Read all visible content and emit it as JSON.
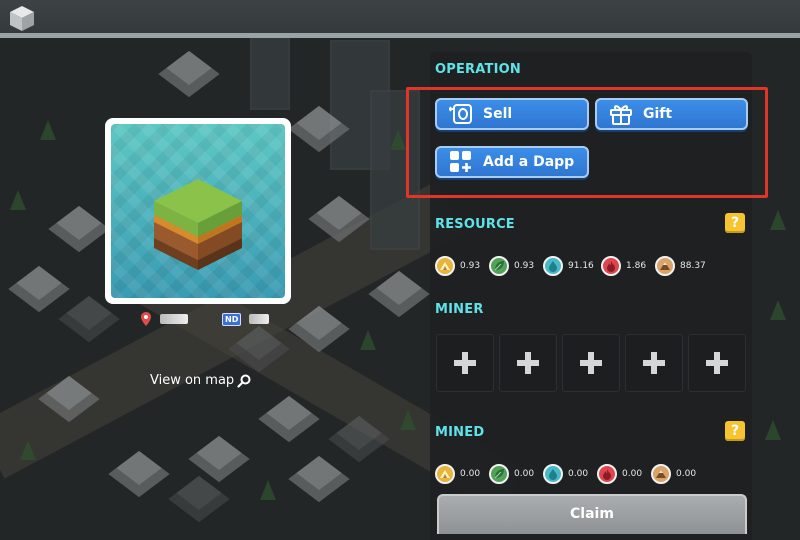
{
  "land": {
    "view_on_map_label": "View on map"
  },
  "operation": {
    "title": "OPERATION",
    "sell_label": "Sell",
    "gift_label": "Gift",
    "add_dapp_label": "Add a Dapp"
  },
  "resource": {
    "title": "RESOURCE",
    "help_label": "?",
    "items": [
      {
        "icon": "gold-mountain-icon",
        "value": "0.93"
      },
      {
        "icon": "leaf-icon",
        "value": "0.93"
      },
      {
        "icon": "water-drop-icon",
        "value": "91.16"
      },
      {
        "icon": "fire-icon",
        "value": "1.86"
      },
      {
        "icon": "soil-mountain-icon",
        "value": "88.37"
      }
    ]
  },
  "miner": {
    "title": "MINER",
    "slots": [
      "plus-icon",
      "plus-icon",
      "plus-icon",
      "plus-icon",
      "plus-icon"
    ]
  },
  "mined": {
    "title": "MINED",
    "help_label": "?",
    "items": [
      {
        "icon": "gold-mountain-icon",
        "value": "0.00"
      },
      {
        "icon": "leaf-icon",
        "value": "0.00"
      },
      {
        "icon": "water-drop-icon",
        "value": "0.00"
      },
      {
        "icon": "fire-icon",
        "value": "0.00"
      },
      {
        "icon": "soil-mountain-icon",
        "value": "0.00"
      }
    ]
  },
  "claim_label": "Claim",
  "colors": {
    "accent_title": "#5fe3e8",
    "button_blue": "#3b8ee8",
    "highlight_red": "#e0362a",
    "help_yellow": "#f5c430"
  }
}
